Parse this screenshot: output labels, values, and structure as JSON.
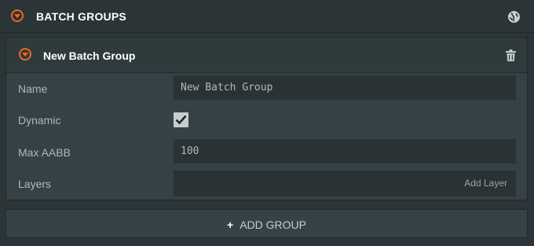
{
  "panel": {
    "title": "BATCH GROUPS",
    "icon": "globe-icon",
    "toggle_icon": "collapse-toggle-icon"
  },
  "group": {
    "title": "New Batch Group",
    "delete_icon": "trash-icon",
    "fields": {
      "name_label": "Name",
      "name_value": "New Batch Group",
      "dynamic_label": "Dynamic",
      "dynamic_checked": true,
      "max_aabb_label": "Max AABB",
      "max_aabb_value": "100",
      "layers_label": "Layers",
      "add_layer_label": "Add Layer"
    }
  },
  "actions": {
    "add_group_icon": "+",
    "add_group_label": "ADD GROUP"
  },
  "colors": {
    "accent": "#f26522",
    "background": "#2b3436",
    "card": "#354144",
    "field": "#293234"
  }
}
